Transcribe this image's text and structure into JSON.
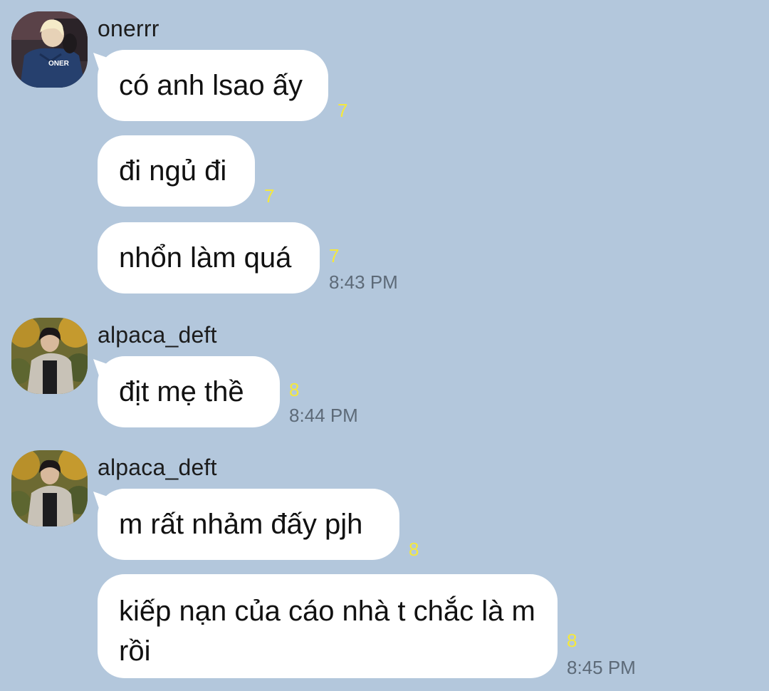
{
  "groups": [
    {
      "sender": "onerrr",
      "avatar": "oner-avatar",
      "messages": [
        {
          "text": "có anh lsao ấy",
          "unread": "7",
          "time": ""
        },
        {
          "text": "đi ngủ đi",
          "unread": "7",
          "time": ""
        },
        {
          "text": "nhổn làm quá",
          "unread": "7",
          "time": "8:43 PM"
        }
      ]
    },
    {
      "sender": "alpaca_deft",
      "avatar": "deft-avatar",
      "messages": [
        {
          "text": "địt mẹ thề",
          "unread": "8",
          "time": "8:44 PM"
        }
      ]
    },
    {
      "sender": "alpaca_deft",
      "avatar": "deft-avatar",
      "messages": [
        {
          "text": "m rất nhảm đấy pjh",
          "unread": "8",
          "time": ""
        },
        {
          "text": "kiếp nạn của cáo nhà t chắc là m rồi",
          "unread": "8",
          "time": "8:45 PM"
        }
      ]
    }
  ],
  "colors": {
    "background": "#b3c7dc",
    "bubble": "#ffffff",
    "unread": "#f5e83c",
    "time": "#5d6a78"
  }
}
